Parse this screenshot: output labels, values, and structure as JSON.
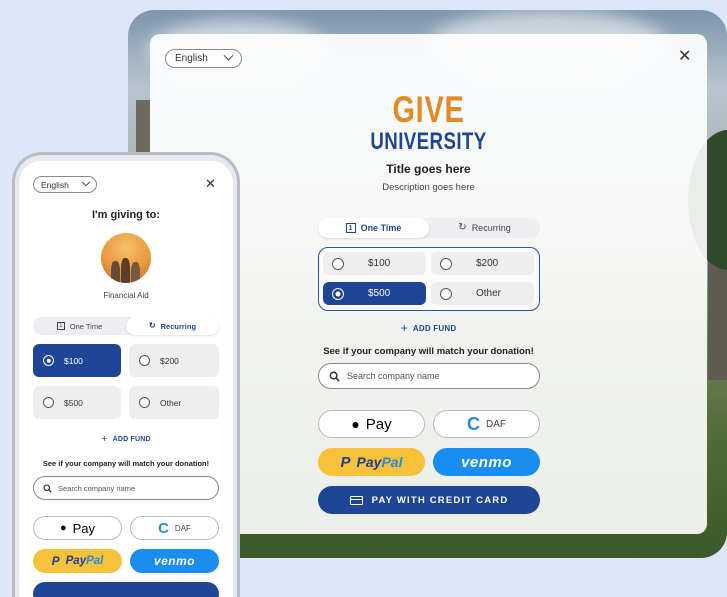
{
  "desktop": {
    "language": "English",
    "logo_line1": "GIVE",
    "logo_line2": "UNIVERSITY",
    "title": "Title goes here",
    "description": "Description goes here",
    "frequency": {
      "one_time": "One Time",
      "recurring": "Recurring",
      "selected": "one_time"
    },
    "amounts": [
      "$100",
      "$200",
      "$500",
      "Other"
    ],
    "selected_amount": "$500",
    "add_fund": "ADD FUND",
    "match_text": "See if your company will match your donation!",
    "search_placeholder": "Search company name",
    "apple_pay": "Pay",
    "daf": "DAF",
    "paypal_a": "Pay",
    "paypal_b": "Pal",
    "venmo": "venmo",
    "credit_card": "PAY WITH CREDIT CARD"
  },
  "mobile": {
    "language": "English",
    "heading": "I'm giving to:",
    "fund_name": "Financial Aid",
    "frequency": {
      "one_time": "One Time",
      "recurring": "Recurring",
      "selected": "recurring"
    },
    "amounts": [
      "$100",
      "$200",
      "$500",
      "Other"
    ],
    "selected_amount": "$100",
    "add_fund": "ADD FUND",
    "match_text": "See if your company will match your donation!",
    "search_placeholder": "Search company name",
    "apple_pay": "Pay",
    "daf": "DAF",
    "paypal_a": "Pay",
    "paypal_b": "Pal",
    "venmo": "venmo"
  },
  "colors": {
    "brand_blue": "#1e4596",
    "brand_orange": "#e38a27",
    "paypal_yellow": "#f7c23b",
    "venmo_blue": "#1b8cf0",
    "page_bg": "#dde6fb"
  }
}
